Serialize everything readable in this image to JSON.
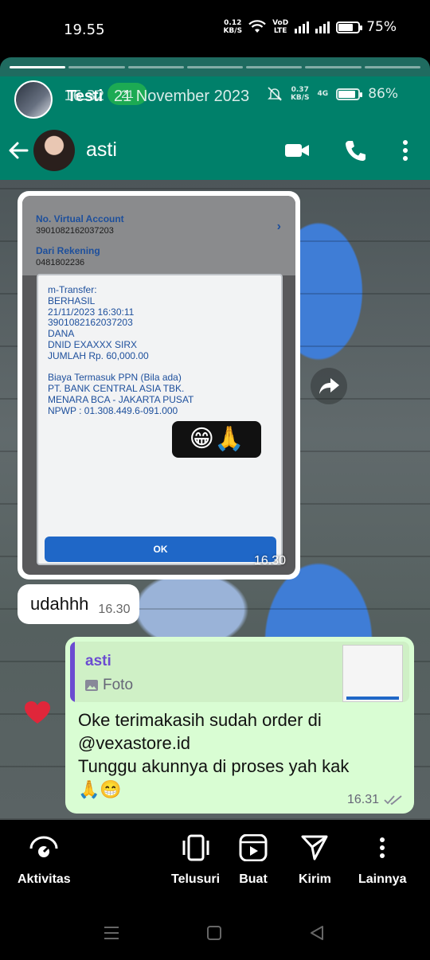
{
  "system_status": {
    "time": "19.55",
    "net_speed_value": "0.12",
    "net_speed_unit": "KB/S",
    "volte_line1": "VoD",
    "volte_line2": "LTE",
    "battery_text": "75%",
    "battery_level": 0.75
  },
  "story": {
    "progress_segments_total": 7,
    "progress_segments_done": 1,
    "inner_time": "16.32",
    "inner_badge": "21",
    "name": "Testi",
    "date": "21 November 2023",
    "inner_net_value": "0.37",
    "inner_net_unit": "KB/S",
    "inner_network": "4G",
    "inner_battery_text": "86%"
  },
  "chat_header": {
    "contact_name": "asti"
  },
  "screenshot_message": {
    "va_label": "No. Virtual Account",
    "va_value": "3901082162037203",
    "rekening_label": "Dari Rekening",
    "rekening_value": "0481802236",
    "dialog_lines": [
      "m-Transfer:",
      "BERHASIL",
      "21/11/2023 16:30:11",
      "3901082162037203",
      "DANA",
      "DNID EXAXXX SIRX",
      "JUMLAH Rp. 60,000.00",
      "",
      "Biaya Termasuk PPN (Bila ada)",
      "PT. BANK CENTRAL ASIA TBK.",
      "MENARA BCA - JAKARTA PUSAT",
      "NPWP : 01.308.449.6-091.000"
    ],
    "emoji": "😁🙏",
    "ok_label": "OK",
    "time": "16.30"
  },
  "incoming_message": {
    "text": "udahhh",
    "time": "16.30"
  },
  "outgoing_message": {
    "quote_name": "asti",
    "quote_type": "Foto",
    "lines": [
      "Oke terimakasih sudah order di",
      "@vexastore.id",
      "Tunggu akunnya di proses yah kak",
      "🙏😁"
    ],
    "time": "16.31"
  },
  "actions": {
    "activity": "Aktivitas",
    "browse": "Telusuri",
    "create": "Buat",
    "send": "Kirim",
    "more": "Lainnya"
  },
  "colors": {
    "whatsapp_green": "#00806a",
    "outgoing_bubble": "#d9fdd3",
    "quote_accent": "#6b4cd1",
    "heart": "#e0263a"
  }
}
